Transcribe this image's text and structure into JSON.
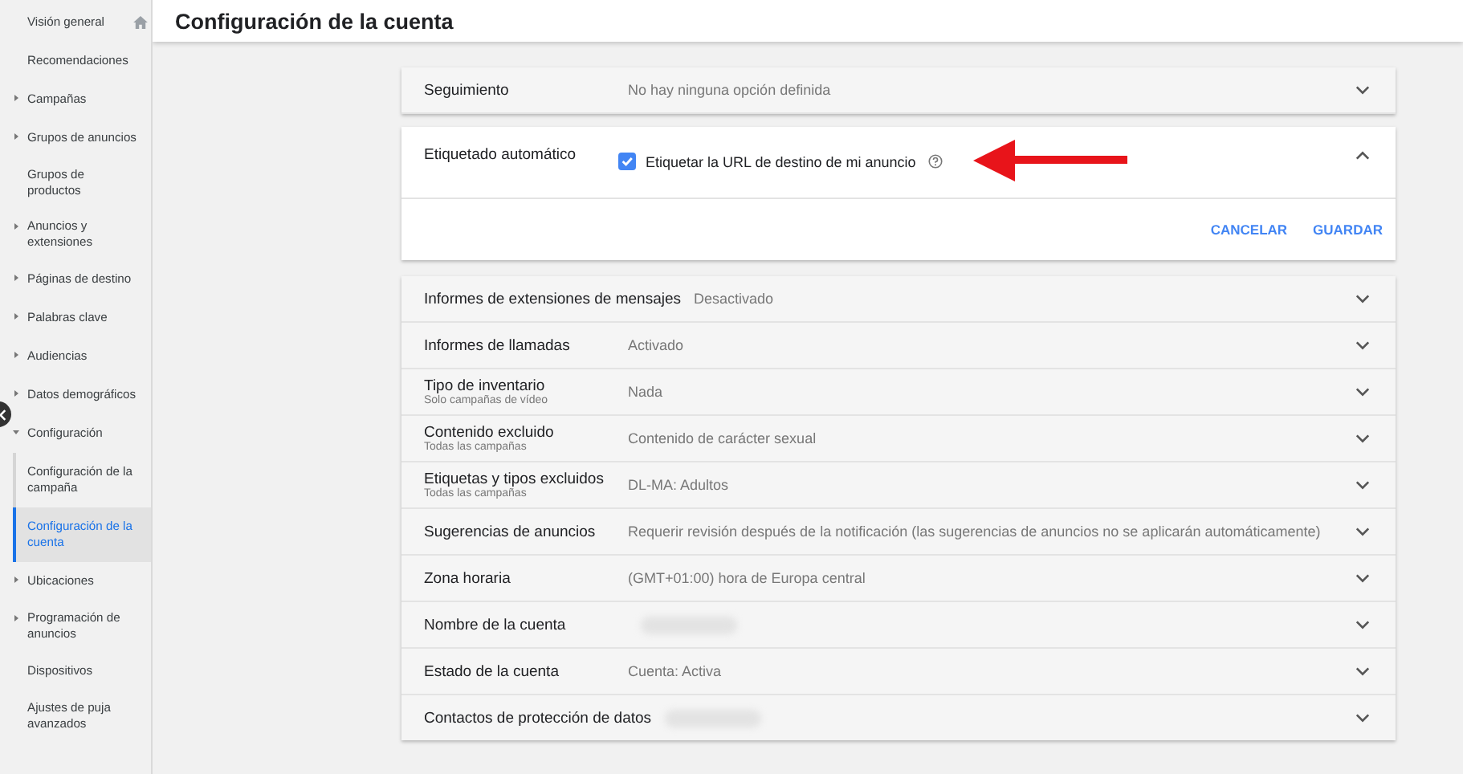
{
  "sidebar": {
    "items": [
      {
        "label": "Visión general",
        "home": true,
        "selected": false
      },
      {
        "label": "Recomendaciones",
        "selected": false
      },
      {
        "label": "Campañas",
        "expanded": false,
        "selected": false
      },
      {
        "label": "Grupos de anuncios",
        "expanded": false,
        "selected": false
      },
      {
        "label": "Grupos de productos",
        "selected": false
      },
      {
        "label": "Anuncios y extensiones",
        "expanded": false,
        "selected": false
      },
      {
        "label": "Páginas de destino",
        "expanded": false,
        "selected": false
      },
      {
        "label": "Palabras clave",
        "expanded": false,
        "selected": false
      },
      {
        "label": "Audiencias",
        "expanded": false,
        "selected": false
      },
      {
        "label": "Datos demográficos",
        "expanded": false,
        "selected": false
      },
      {
        "label": "Configuración",
        "expanded": true,
        "selected": false,
        "children": [
          {
            "label": "Configuración de la campaña",
            "selected": false
          },
          {
            "label": "Configuración de la cuenta",
            "selected": true
          }
        ]
      },
      {
        "label": "Ubicaciones",
        "expanded": false,
        "selected": false
      },
      {
        "label": "Programación de anuncios",
        "expanded": false,
        "selected": false
      },
      {
        "label": "Dispositivos",
        "selected": false
      },
      {
        "label": "Ajustes de puja avanzados",
        "selected": false
      }
    ]
  },
  "header": {
    "title": "Configuración de la cuenta"
  },
  "tracking": {
    "label": "Seguimiento",
    "value": "No hay ninguna opción definida",
    "expanded": false
  },
  "auto_tagging": {
    "label": "Etiquetado automático",
    "option": "Etiquetar la URL de destino de mi anuncio",
    "checked": true,
    "expanded": true,
    "buttons": [
      "CANCELAR",
      "GUARDAR"
    ]
  },
  "settings": [
    {
      "label": "Informes de extensiones de mensajes",
      "value": "Desactivado",
      "expanded": false
    },
    {
      "label": "Informes de llamadas",
      "value": "Activado",
      "expanded": false
    },
    {
      "label": "Tipo de inventario",
      "sublabel": "Solo campañas de vídeo",
      "value": "Nada",
      "expanded": false
    },
    {
      "label": "Contenido excluido",
      "sublabel": "Todas las campañas",
      "value": "Contenido de carácter sexual",
      "expanded": false
    },
    {
      "label": "Etiquetas y tipos excluidos",
      "sublabel": "Todas las campañas",
      "value": "DL-MA: Adultos",
      "expanded": false
    },
    {
      "label": "Sugerencias de anuncios",
      "value": "Requerir revisión después de la notificación (las sugerencias de anuncios no se aplicarán automáticamente)",
      "expanded": false
    },
    {
      "label": "Zona horaria",
      "value": "(GMT+01:00) hora de Europa central",
      "expanded": false
    },
    {
      "label": "Nombre de la cuenta",
      "kind": "redacted",
      "expanded": false
    },
    {
      "label": "Estado de la cuenta",
      "value": "Cuenta: Activa",
      "expanded": false
    },
    {
      "label": "Contactos de protección de datos",
      "kind": "redacted",
      "expanded": false
    }
  ]
}
